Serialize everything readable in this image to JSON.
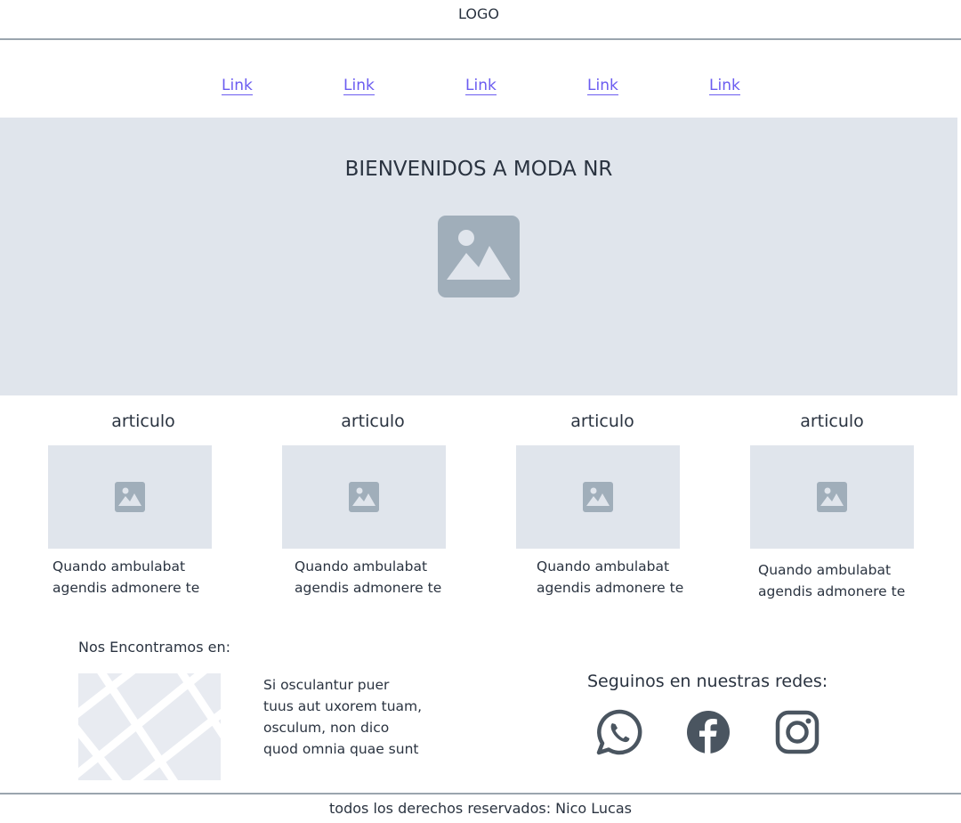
{
  "header": {
    "logo": "LOGO"
  },
  "nav": {
    "links": [
      "Link",
      "Link",
      "Link",
      "Link",
      "Link"
    ]
  },
  "hero": {
    "title": "BIENVENIDOS A MODA NR",
    "image_icon": "image-icon"
  },
  "articles": [
    {
      "title": "articulo",
      "text": "Quando ambulabat\nagendis admonere te"
    },
    {
      "title": "articulo",
      "text": "Quando ambulabat\nagendis admonere te"
    },
    {
      "title": "articulo",
      "text": "Quando ambulabat\nagendis admonere te"
    },
    {
      "title": "articulo",
      "text": "Quando ambulabat\nagendis admonere te"
    }
  ],
  "location": {
    "heading": "Nos Encontramos en:",
    "address": "Si osculantur puer\ntuus aut uxorem tuam,\nosculum, non dico\nquod omnia quae sunt"
  },
  "social": {
    "heading": "Seguinos en nuestras redes:",
    "icons": [
      "whatsapp-icon",
      "facebook-icon",
      "instagram-icon"
    ]
  },
  "footer": {
    "copyright": "todos los derechos reservados: Nico Lucas"
  },
  "colors": {
    "link": "#6b5cf0",
    "placeholder_bg": "#e0e5ec",
    "icon_gray": "#a0aeba",
    "social_icon": "#4a5560",
    "divider": "#9aa5ae"
  }
}
